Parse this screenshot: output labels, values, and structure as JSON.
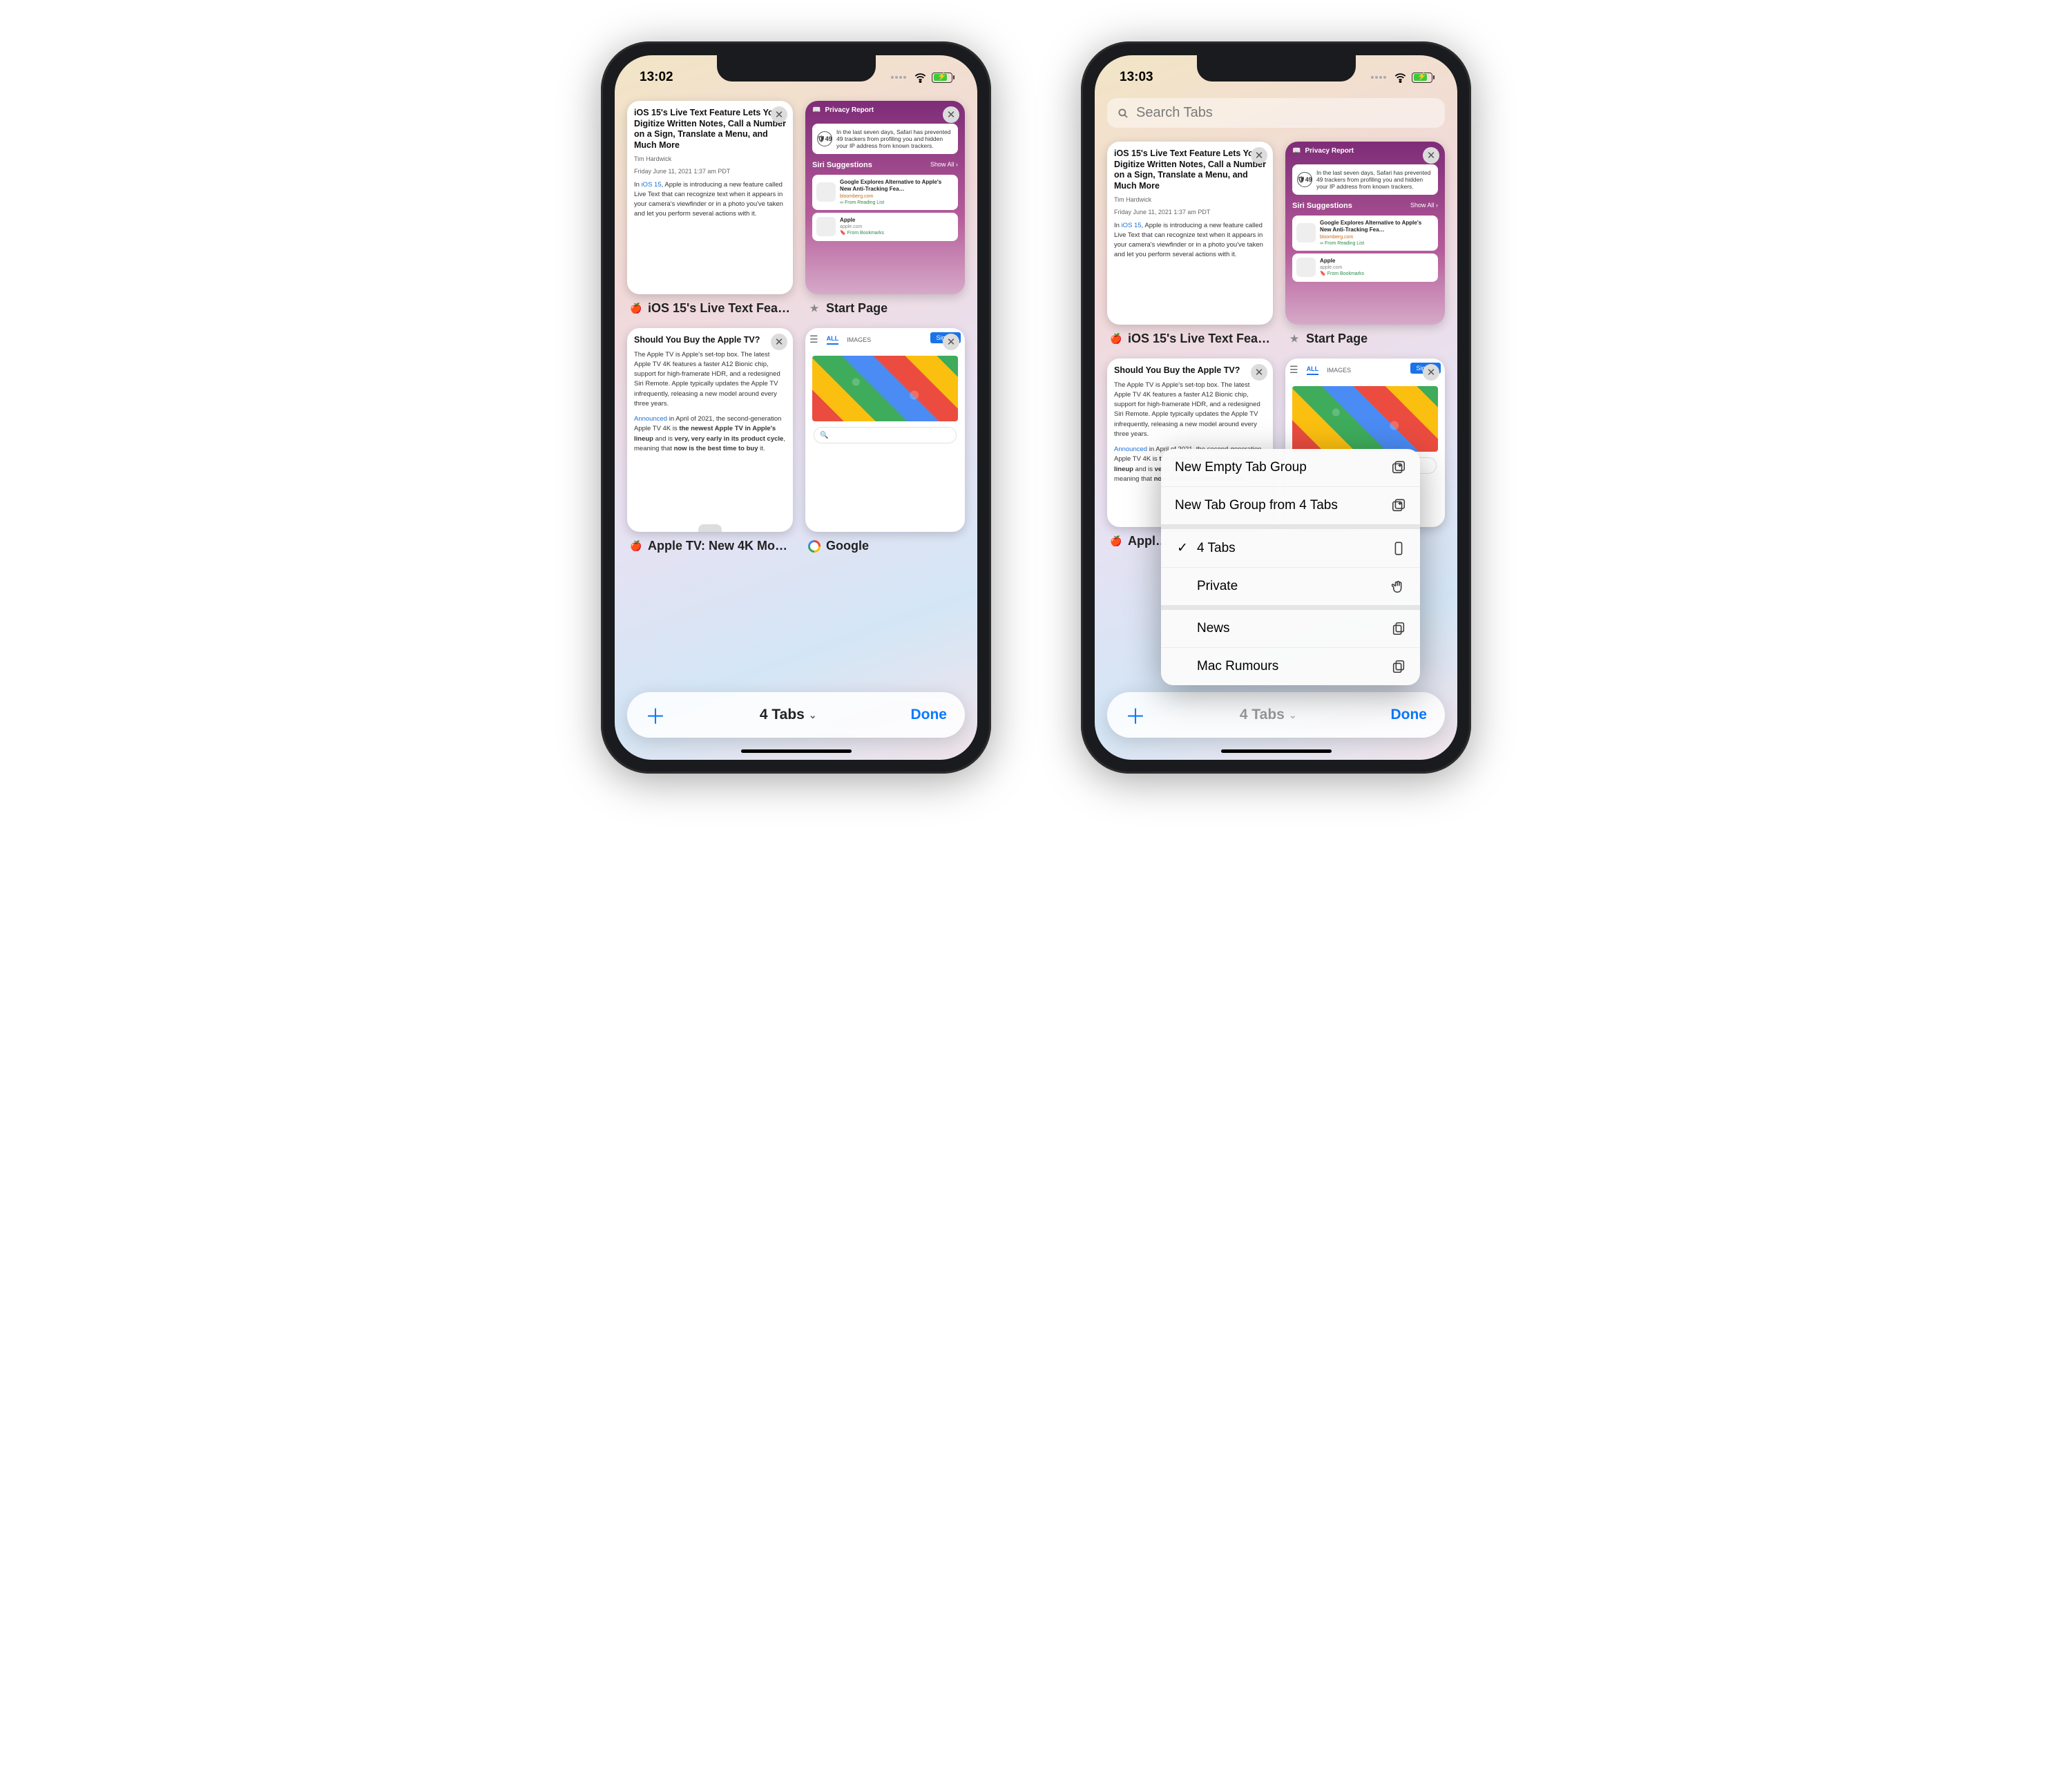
{
  "left": {
    "status": {
      "time": "13:02"
    },
    "tabs": [
      {
        "label": "iOS 15's Live Text Fea…",
        "title": "iOS 15's Live Text Feature Lets You Digitize Written Notes, Call a Number on a Sign, Translate a Menu, and Much More",
        "author": "Tim Hardwick",
        "date": "Friday June 11, 2021 1:37 am PDT",
        "body_prefix": "In ",
        "body_link": "iOS 15",
        "body_rest": ", Apple is introducing a new feature called Live Text that can recognize text when it appears in your camera's viewfinder or in a photo you've taken and let you perform several actions with it."
      },
      {
        "label": "Start Page",
        "privacy_title": "Privacy Report",
        "tracker_count": "49",
        "privacy_body": "In the last seven days, Safari has prevented 49 trackers from profiling you and hidden your IP address from known trackers.",
        "siri_title": "Siri Suggestions",
        "siri_showall": "Show All",
        "sug1_t": "Google Explores Alternative to Apple's New Anti-Tracking Fea…",
        "sug1_src": "bloomberg.com",
        "sug1_from": "From Reading List",
        "sug2_t": "Apple",
        "sug2_src": "apple.com",
        "sug2_from": "From Bookmarks"
      },
      {
        "label": "Apple TV: New 4K Mo…",
        "title": "Should You Buy the Apple TV?",
        "p1": "The Apple TV is Apple's set-top box. The latest Apple TV 4K features a faster A12 Bionic chip, support for high-framerate HDR, and a redesigned Siri Remote. Apple typically updates the Apple TV infrequently, releasing a new model around every three years.",
        "p2a": "Announced",
        "p2b": " in April of 2021, the second-generation Apple TV 4K is ",
        "p2c": "the newest Apple TV in Apple's lineup",
        "p2d": " and is ",
        "p2e": "very, very early in its product cycle",
        "p2f": ", meaning that ",
        "p2g": "now is the best time to buy",
        "p2h": " it."
      },
      {
        "label": "Google",
        "g_all": "ALL",
        "g_images": "IMAGES",
        "g_signin": "Sign in"
      }
    ],
    "bottom": {
      "group": "4 Tabs",
      "done": "Done"
    }
  },
  "right": {
    "status": {
      "time": "13:03"
    },
    "search_placeholder": "Search Tabs",
    "bottom": {
      "group": "4 Tabs",
      "done": "Done"
    },
    "popup": {
      "new_empty": "New Empty Tab Group",
      "new_from": "New Tab Group from 4 Tabs",
      "tabs": "4 Tabs",
      "private": "Private",
      "g_news": "News",
      "g_macrum": "Mac Rumours"
    }
  }
}
